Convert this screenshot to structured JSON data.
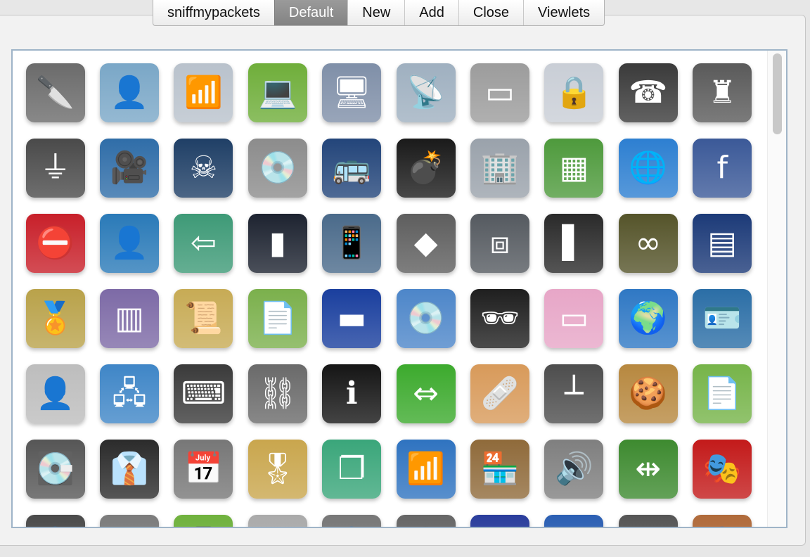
{
  "tabs": [
    {
      "label": "sniffmypackets",
      "active": false
    },
    {
      "label": "Default",
      "active": true
    },
    {
      "label": "New",
      "active": false
    },
    {
      "label": "Add",
      "active": false
    },
    {
      "label": "Close",
      "active": false
    },
    {
      "label": "Viewlets",
      "active": false
    }
  ],
  "palette": {
    "icons": [
      {
        "name": "knife-icon",
        "glyph": "🔪",
        "color": "#6b6b6b"
      },
      {
        "name": "person-icon",
        "glyph": "👤",
        "color": "#7aa7c7"
      },
      {
        "name": "router-icon",
        "glyph": "📶",
        "color": "#b9c2cc"
      },
      {
        "name": "laptop-icon",
        "glyph": "💻",
        "color": "#6fae3a"
      },
      {
        "name": "computers-icon",
        "glyph": "🖥",
        "color": "#7f8fa8"
      },
      {
        "name": "network-switch-icon",
        "glyph": "📡",
        "color": "#9fb0c0"
      },
      {
        "name": "hard-drive-box-icon",
        "glyph": "▭",
        "color": "#9c9c9c"
      },
      {
        "name": "locked-file-icon",
        "glyph": "🔒",
        "color": "#c9ced6"
      },
      {
        "name": "phone-icon",
        "glyph": "☎",
        "color": "#3a3a3a"
      },
      {
        "name": "chess-rook-icon",
        "glyph": "♜",
        "color": "#5a5a5a"
      },
      {
        "name": "usb-icon",
        "glyph": "⏚",
        "color": "#4a4a4a"
      },
      {
        "name": "webcam-user-icon",
        "glyph": "🎥",
        "color": "#2f6da8"
      },
      {
        "name": "pirate-icon",
        "glyph": "☠",
        "color": "#1f3f66"
      },
      {
        "name": "software-box-icon",
        "glyph": "💿",
        "color": "#8c8c8c"
      },
      {
        "name": "bus-icon",
        "glyph": "🚌",
        "color": "#23457a"
      },
      {
        "name": "bomb-icon",
        "glyph": "💣",
        "color": "#1a1a1a"
      },
      {
        "name": "building-icon",
        "glyph": "🏢",
        "color": "#9aa2ab"
      },
      {
        "name": "table-export-icon",
        "glyph": "▦",
        "color": "#4e9a3c"
      },
      {
        "name": "globe-icon",
        "glyph": "🌐",
        "color": "#2d7fd1"
      },
      {
        "name": "facebook-icon",
        "glyph": "f",
        "color": "#3b5998"
      },
      {
        "name": "blocked-icon",
        "glyph": "⛔",
        "color": "#c8202a"
      },
      {
        "name": "user-computer-icon",
        "glyph": "👤",
        "color": "#2a7ab8"
      },
      {
        "name": "table-import-icon",
        "glyph": "⇦",
        "color": "#3e9a77"
      },
      {
        "name": "server-tower-icon",
        "glyph": "▮",
        "color": "#1d2330"
      },
      {
        "name": "person-phone-icon",
        "glyph": "📱",
        "color": "#4a6a8a"
      },
      {
        "name": "app-logo-icon",
        "glyph": "◆",
        "color": "#5e5e5e"
      },
      {
        "name": "ethernet-port-icon",
        "glyph": "⧈",
        "color": "#555a60"
      },
      {
        "name": "www-tower-icon",
        "glyph": "▌",
        "color": "#2a2a2a"
      },
      {
        "name": "knot-icon",
        "glyph": "∞",
        "color": "#55542a"
      },
      {
        "name": "flight-board-icon",
        "glyph": "▤",
        "color": "#1c3a78"
      },
      {
        "name": "ssl-certificate-icon",
        "glyph": "🏅",
        "color": "#b9a24a"
      },
      {
        "name": "database-schema-icon",
        "glyph": "▥",
        "color": "#7d6aa6"
      },
      {
        "name": "certificate-map-icon",
        "glyph": "📜",
        "color": "#c7ab55"
      },
      {
        "name": "user-document-icon",
        "glyph": "📄",
        "color": "#7bb04c"
      },
      {
        "name": "progress-bar-icon",
        "glyph": "▬",
        "color": "#1a3f9e"
      },
      {
        "name": "user-disk-icon",
        "glyph": "💿",
        "color": "#4d86c9"
      },
      {
        "name": "agent-icon",
        "glyph": "🕶",
        "color": "#1f1f1f"
      },
      {
        "name": "eraser-icon",
        "glyph": "▭",
        "color": "#e7a6c7"
      },
      {
        "name": "network-globe-icon",
        "glyph": "🌍",
        "color": "#2f78c4"
      },
      {
        "name": "id-card-icon",
        "glyph": "🪪",
        "color": "#2b6ea6"
      },
      {
        "name": "ghost-user-icon",
        "glyph": "👤",
        "color": "#bdbdbd"
      },
      {
        "name": "network-computers-icon",
        "glyph": "🖧",
        "color": "#3f86c7"
      },
      {
        "name": "terminal-monitor-icon",
        "glyph": "⌨",
        "color": "#3a3a3a"
      },
      {
        "name": "chain-link-icon",
        "glyph": "⛓",
        "color": "#6a6a6a"
      },
      {
        "name": "info-terminal-icon",
        "glyph": "ℹ",
        "color": "#151515"
      },
      {
        "name": "swap-arrows-icon",
        "glyph": "⇔",
        "color": "#3caa2d"
      },
      {
        "name": "bandage-icon",
        "glyph": "🩹",
        "color": "#d89a5a"
      },
      {
        "name": "microphone-stand-icon",
        "glyph": "┴",
        "color": "#4d4d4d"
      },
      {
        "name": "cookies-icon",
        "glyph": "🍪",
        "color": "#b7883f"
      },
      {
        "name": "document-minus-icon",
        "glyph": "📄",
        "color": "#76b449"
      },
      {
        "name": "hard-disk-icon",
        "glyph": "💽",
        "color": "#565656"
      },
      {
        "name": "businessman-icon",
        "glyph": "👔",
        "color": "#2b2b2b"
      },
      {
        "name": "date-15-05-09-icon",
        "glyph": "📅",
        "color": "#777777"
      },
      {
        "name": "award-certificate-icon",
        "glyph": "🎖",
        "color": "#c9a64d"
      },
      {
        "name": "layered-windows-icon",
        "glyph": "❐",
        "color": "#3aa67a"
      },
      {
        "name": "wireless-router-icon",
        "glyph": "📶",
        "color": "#2f73c0"
      },
      {
        "name": "web-shop-icon",
        "glyph": "🏪",
        "color": "#8f6a3a"
      },
      {
        "name": "speaker-icon",
        "glyph": "🔊",
        "color": "#7f7f7f"
      },
      {
        "name": "split-arrows-icon",
        "glyph": "⇹",
        "color": "#3d8a2f"
      },
      {
        "name": "masked-figure-icon",
        "glyph": "🎭",
        "color": "#c31a1a"
      },
      {
        "name": "person-helmet-icon",
        "glyph": "👤",
        "color": "#4a4a4a"
      },
      {
        "name": "chain-icon",
        "glyph": "⛓",
        "color": "#7b7b7b"
      },
      {
        "name": "mobile-phone-icon",
        "glyph": "📱",
        "color": "#6fb13d"
      },
      {
        "name": "paper-roll-icon",
        "glyph": "▭",
        "color": "#aaaaaa"
      },
      {
        "name": "person-partial-icon",
        "glyph": "👤",
        "color": "#777777"
      },
      {
        "name": "headset-user-icon",
        "glyph": "🎧",
        "color": "#666666"
      },
      {
        "name": "stars-badge-icon",
        "glyph": "★",
        "color": "#2a3d9c"
      },
      {
        "name": "chat-bubble-icon",
        "glyph": "…",
        "color": "#2b5fb3"
      },
      {
        "name": "cable-icon",
        "glyph": "━",
        "color": "#555555"
      },
      {
        "name": "person-small-icon",
        "glyph": "👤",
        "color": "#b06a3a"
      }
    ]
  }
}
